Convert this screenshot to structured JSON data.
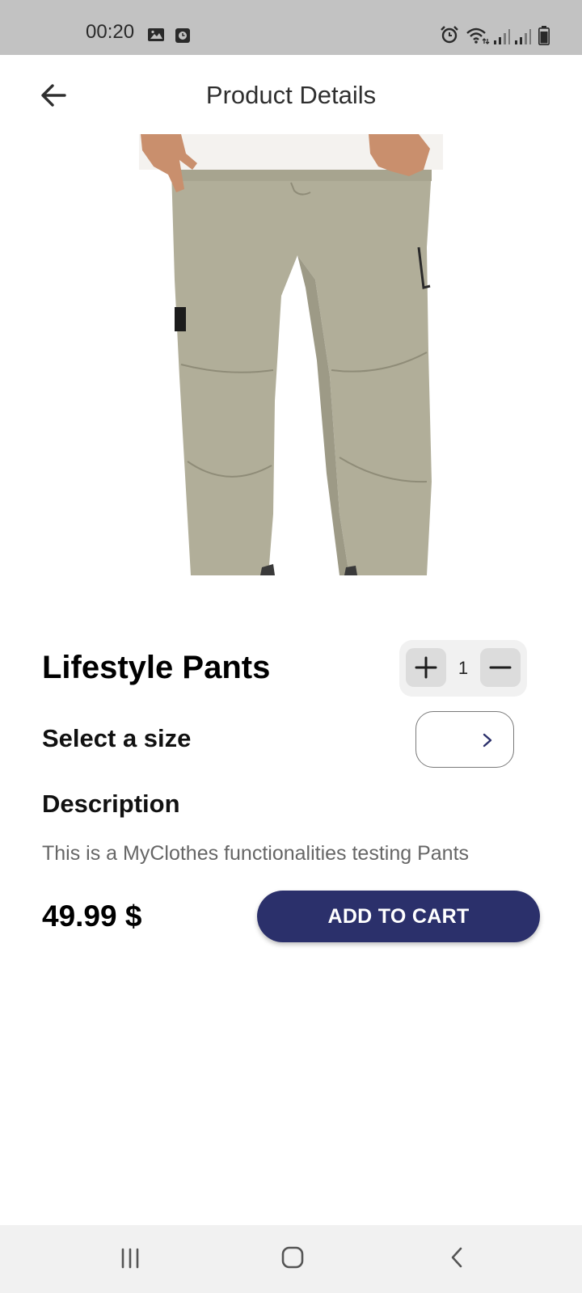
{
  "status_bar": {
    "time": "00:20",
    "icons": [
      "gallery-icon",
      "clock-app-icon",
      "alarm-icon",
      "wifi-icon",
      "signal-icon",
      "signal-icon",
      "battery-icon"
    ]
  },
  "header": {
    "title": "Product Details",
    "back_icon": "arrow-left-icon"
  },
  "product": {
    "name": "Lifestyle Pants",
    "quantity": "1",
    "size_label": "Select a size",
    "description_heading": "Description",
    "description": "This is a MyClothes functionalities testing Pants",
    "price": "49.99 $",
    "add_to_cart_label": "ADD TO CART"
  },
  "colors": {
    "accent": "#2b306b",
    "status_bar_bg": "#c2c2c2",
    "nav_bar_bg": "#f1f1f1",
    "pants": "#b1ae99"
  },
  "nav_bar": {
    "icons": [
      "recents-icon",
      "home-icon",
      "back-icon"
    ]
  }
}
